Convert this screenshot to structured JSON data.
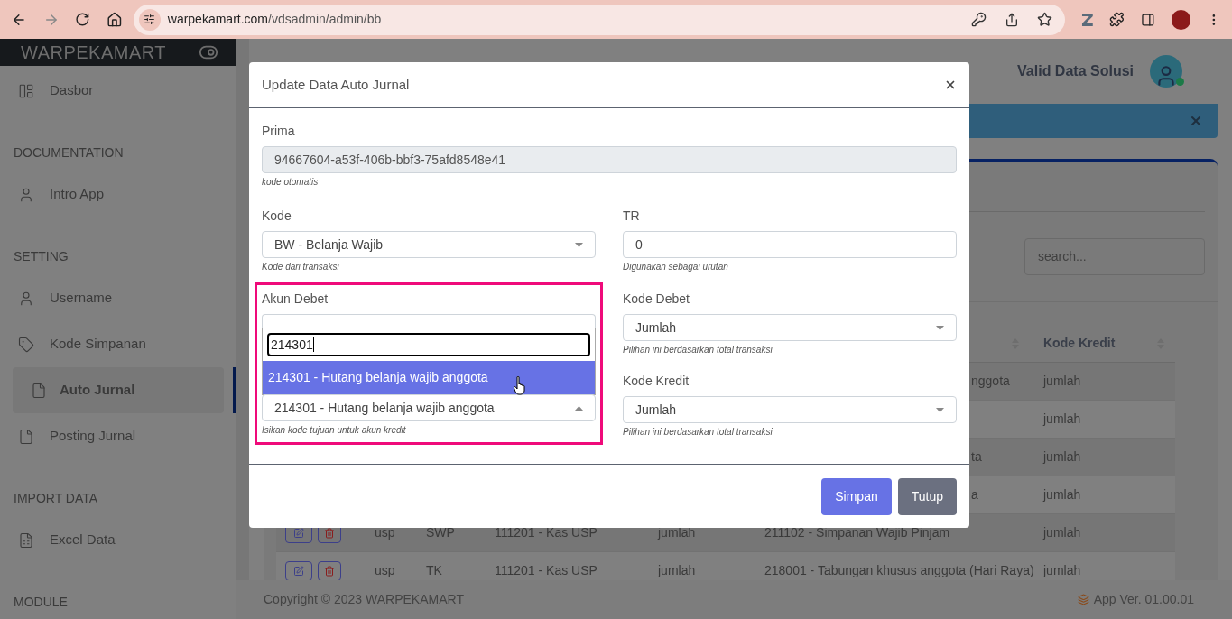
{
  "browser": {
    "url_host": "warpekamart.com",
    "url_path": "/vdsadmin/admin/bb"
  },
  "sidebar": {
    "brand": "WARPEKAMART",
    "items": [
      {
        "kind": "item",
        "label": "Dasbor",
        "selected": false
      },
      {
        "kind": "section",
        "label": "DOCUMENTATION"
      },
      {
        "kind": "item",
        "label": "Intro App",
        "selected": false
      },
      {
        "kind": "section",
        "label": "SETTING"
      },
      {
        "kind": "item",
        "label": "Username",
        "selected": false
      },
      {
        "kind": "item",
        "label": "Kode Simpanan",
        "selected": false
      },
      {
        "kind": "item",
        "label": "Auto Jurnal",
        "selected": true
      },
      {
        "kind": "item",
        "label": "Posting Jurnal",
        "selected": false
      },
      {
        "kind": "section",
        "label": "IMPORT DATA"
      },
      {
        "kind": "item",
        "label": "Excel Data",
        "selected": false
      },
      {
        "kind": "section",
        "label": "MODULE"
      }
    ]
  },
  "header": {
    "user_name": "Valid Data Solusi"
  },
  "search": {
    "placeholder": "search..."
  },
  "table": {
    "columns": [
      {
        "label": "Kode Kredit"
      }
    ],
    "rows": [
      {
        "kind": "covered",
        "akun_kredit": "nggota",
        "kode_kredit": "jumlah"
      },
      {
        "kind": "covered",
        "kode_kredit": "jumlah"
      },
      {
        "kind": "covered",
        "akun_kredit": "ta",
        "kode_kredit": "jumlah"
      },
      {
        "kind": "covered",
        "akun_kredit": "a",
        "kode_kredit": "jumlah"
      },
      {
        "kind": "full",
        "type": "usp",
        "tr": "SWP",
        "akun_debet": "111201 - Kas USP",
        "kode_debet": "jumlah",
        "akun_kredit": "211102 - Simpanan Wajib Pinjam",
        "kode_kredit": "jumlah"
      },
      {
        "kind": "full",
        "type": "usp",
        "tr": "TK",
        "akun_debet": "111201 - Kas USP",
        "kode_debet": "jumlah",
        "akun_kredit": "218001 - Tabungan khusus anggota (Hari Raya)",
        "kode_kredit": "jumlah"
      }
    ]
  },
  "footer": {
    "copyright": "Copyright © 2023 WARPEKAMART",
    "version": "App Ver. 01.00.01"
  },
  "modal": {
    "title": "Update Data Auto Jurnal",
    "prima": {
      "label": "Prima",
      "value": "94667604-a53f-406b-bbf3-75afd8548e41",
      "help": "kode otomatis"
    },
    "kode": {
      "label": "Kode",
      "value": "BW - Belanja Wajib",
      "help": "Kode dari transaksi"
    },
    "tr": {
      "label": "TR",
      "value": "0",
      "help": "Digunakan sebagai urutan"
    },
    "akun_debet": {
      "label": "Akun Debet",
      "search_value": "214301",
      "options": [
        {
          "label": "214301 - Hutang belanja wajib anggota",
          "selected": true
        }
      ]
    },
    "akun_kredit": {
      "value": "214301 - Hutang belanja wajib anggota",
      "help": "Isikan kode tujuan untuk akun kredit"
    },
    "kode_debet": {
      "label": "Kode Debet",
      "value": "Jumlah",
      "help": "Pilihan ini berdasarkan total transaksi"
    },
    "kode_kredit": {
      "label": "Kode Kredit",
      "value": "Jumlah",
      "help": "Pilihan ini berdasarkan total transaksi"
    },
    "buttons": [
      {
        "label": "Simpan",
        "kind": "primary"
      },
      {
        "label": "Tutup",
        "kind": "secondary"
      }
    ]
  }
}
